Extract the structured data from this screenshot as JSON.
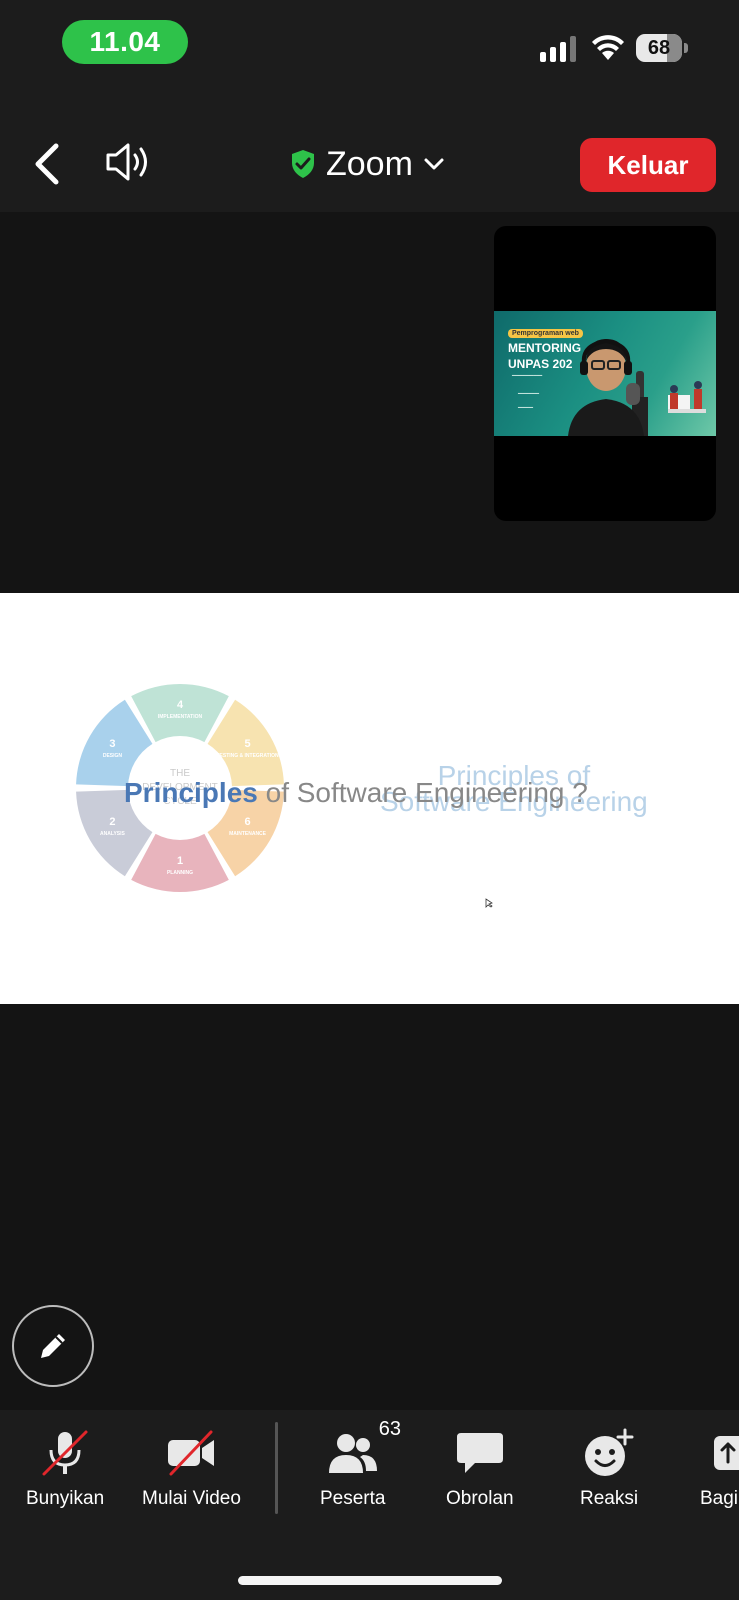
{
  "status_bar": {
    "time": "11.04",
    "battery_level": "68",
    "battery_fraction": 0.68
  },
  "top_bar": {
    "title": "Zoom",
    "leave_label": "Keluar",
    "leave_color": "#e0262b",
    "secure_color": "#2ec24a"
  },
  "video": {
    "tag": "Pemprograman web",
    "line1": "MENTORING",
    "line2": "UNPAS 202"
  },
  "slide": {
    "title_highlight": "Principles",
    "title_rest": " of Software Engineering ?",
    "ghost_line1": "Principles of",
    "ghost_line2": "Software Engineering",
    "cycle_center_1": "THE",
    "cycle_center_2": "DEVELOPMENT",
    "cycle_center_3": "CYCLE",
    "segments": [
      {
        "num": "1",
        "label": "PLANNING",
        "color": "#e8b4bd"
      },
      {
        "num": "2",
        "label": "ANALYSIS",
        "color": "#c9ccd8"
      },
      {
        "num": "3",
        "label": "DESIGN",
        "color": "#a9d1ec"
      },
      {
        "num": "4",
        "label": "IMPLEMENTATION",
        "color": "#bfe3d6"
      },
      {
        "num": "5",
        "label": "TESTING & INTEGRATION",
        "color": "#f7e3b0"
      },
      {
        "num": "6",
        "label": "MAINTENANCE",
        "color": "#f7d3a7"
      }
    ]
  },
  "toolbar": {
    "mute_label": "Bunyikan",
    "video_label": "Mulai Video",
    "participants_label": "Peserta",
    "participants_count": "63",
    "chat_label": "Obrolan",
    "reactions_label": "Reaksi",
    "share_label": "Bagi"
  },
  "icons": {
    "back": "chevron-left-icon",
    "speaker": "speaker-icon",
    "secure": "shield-check-icon",
    "dropdown": "chevron-down-icon",
    "annotate": "pencil-icon",
    "mute": "microphone-off-icon",
    "video": "video-off-icon",
    "participants": "people-icon",
    "chat": "chat-bubble-icon",
    "reactions": "smiley-plus-icon",
    "share": "share-icon"
  }
}
